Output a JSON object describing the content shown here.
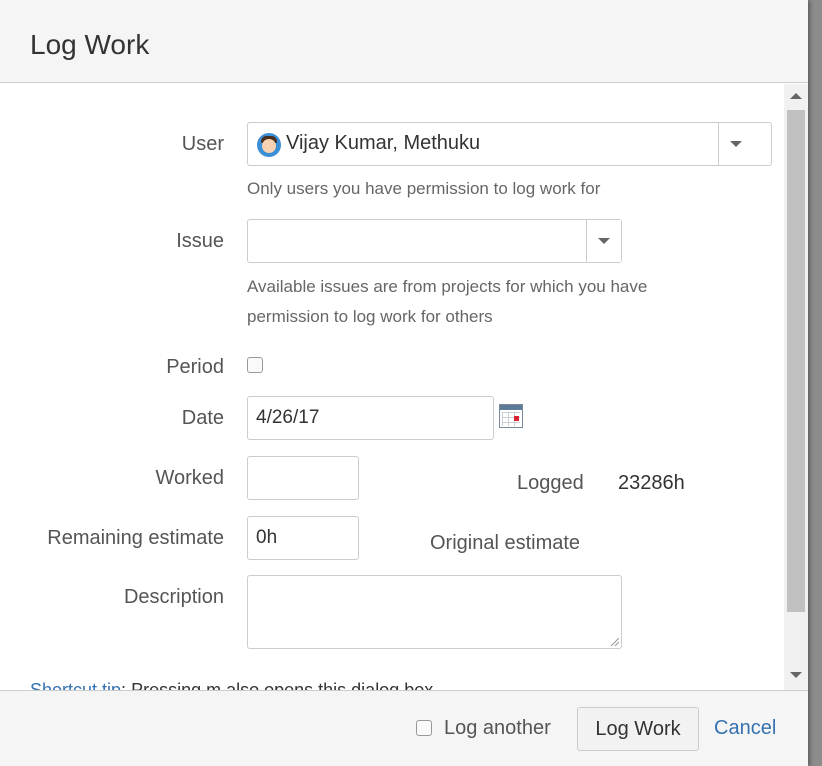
{
  "dialog": {
    "title": "Log Work"
  },
  "form": {
    "user": {
      "label": "User",
      "value": "Vijay Kumar, Methuku",
      "help": "Only users you have permission to log work for"
    },
    "issue": {
      "label": "Issue",
      "value": "",
      "help_line1": "Available issues are from projects for which you have",
      "help_line2": "permission to log work for others"
    },
    "period": {
      "label": "Period",
      "checked": false
    },
    "date": {
      "label": "Date",
      "value": "4/26/17",
      "icon": "calendar-icon"
    },
    "worked": {
      "label": "Worked",
      "value": ""
    },
    "logged": {
      "label": "Logged",
      "value": "23286h"
    },
    "remaining": {
      "label": "Remaining estimate",
      "value": "0h"
    },
    "original": {
      "label": "Original estimate",
      "value": ""
    },
    "description": {
      "label": "Description",
      "value": ""
    },
    "shortcut": {
      "link": "Shortcut tip",
      "text": "Pressing m also opens this dialog box"
    }
  },
  "footer": {
    "log_another_label": "Log another",
    "log_another_checked": false,
    "submit_label": "Log Work",
    "cancel_label": "Cancel"
  },
  "colors": {
    "link": "#3572b0",
    "header_bg": "#f5f5f5",
    "overlay": "#8c8c8c"
  }
}
